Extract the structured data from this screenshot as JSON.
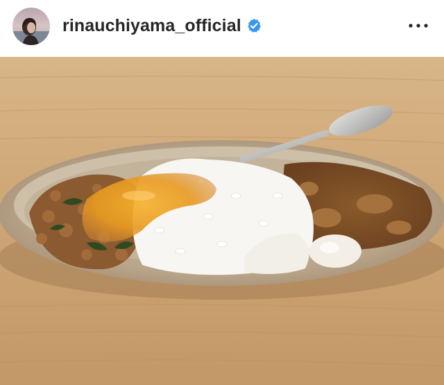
{
  "post": {
    "username": "rinauchiyama_official",
    "verified": true,
    "avatar_icon": "profile-avatar",
    "more_icon": "more-options-icon",
    "verified_icon": "verified-badge-icon",
    "colors": {
      "verified_blue": "#3897f0",
      "username_text": "#262626"
    }
  },
  "photo": {
    "subject": "curry-rice-plate-icon"
  }
}
